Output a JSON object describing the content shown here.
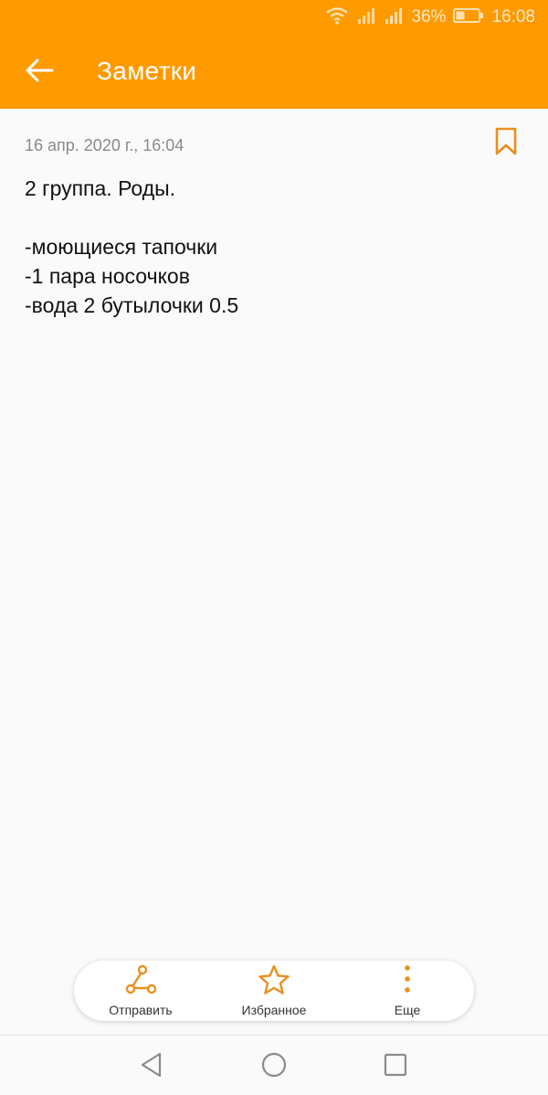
{
  "status_bar": {
    "battery_percent": "36%",
    "time": "16:08",
    "icons": [
      "wifi-icon",
      "signal-icon",
      "signal-icon",
      "battery-icon"
    ]
  },
  "app_bar": {
    "title": "Заметки",
    "back_icon": "arrow-left-icon"
  },
  "note": {
    "date": "16 апр. 2020 г., 16:04",
    "bookmark_icon": "bookmark-icon",
    "lines": [
      "2 группа. Роды.",
      "",
      "-моющиеся тапочки",
      "-1 пара носочков",
      "-вода 2 бутылочки 0.5"
    ]
  },
  "actions": [
    {
      "label": "Отправить",
      "icon": "share-icon"
    },
    {
      "label": "Избранное",
      "icon": "star-icon"
    },
    {
      "label": "Еще",
      "icon": "more-vertical-icon"
    }
  ],
  "navigation_bar": {
    "icons": [
      "back-triangle-icon",
      "home-circle-icon",
      "recents-square-icon"
    ]
  },
  "colors": {
    "accent": "#ff9a00",
    "icon_accent": "#e9901c",
    "background": "#fafafa",
    "text": "#111111",
    "secondary_text": "#8a8a8a"
  }
}
